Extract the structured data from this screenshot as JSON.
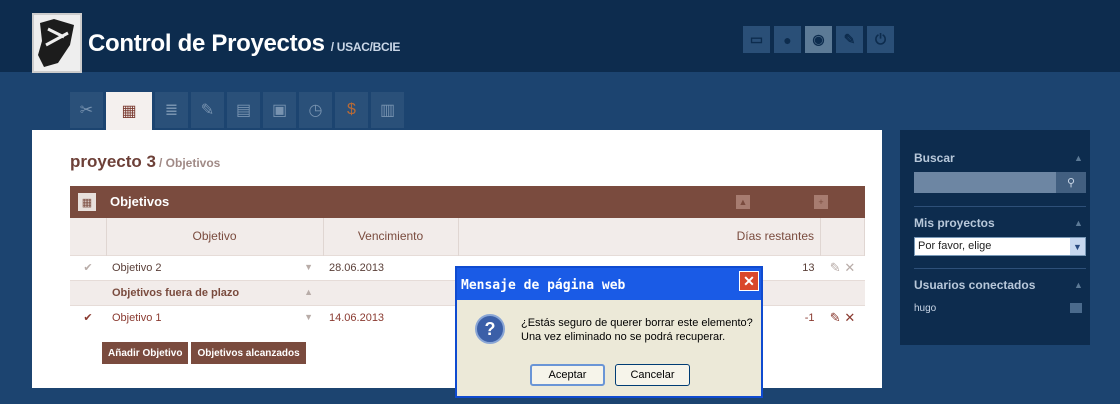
{
  "header": {
    "title": "Control de Proyectos",
    "subtitle": "/ USAC/BCIE",
    "icons": [
      "monitor-icon",
      "user-icon",
      "globe-icon",
      "wrench-icon",
      "power-icon"
    ]
  },
  "tabs": [
    "tools-icon",
    "calendar-icon",
    "list-icon",
    "edit-icon",
    "forms-icon",
    "document-icon",
    "clock-icon",
    "money-bag-icon",
    "clipboard-icon"
  ],
  "project": {
    "name": "proyecto 3",
    "section": "/ Objetivos"
  },
  "objectives": {
    "header": "Objetivos",
    "columns": [
      "Objetivo",
      "Vencimiento",
      "Días restantes"
    ],
    "rows": [
      {
        "name": "Objetivo 2",
        "due": "28.06.2013",
        "days": "13"
      }
    ],
    "late_section": "Objetivos fuera de plazo",
    "late_rows": [
      {
        "name": "Objetivo 1",
        "due": "14.06.2013",
        "days": "-1"
      }
    ],
    "add_button": "Añadir Objetivo",
    "achieved_button": "Objetivos alcanzados"
  },
  "sidebar": {
    "search_label": "Buscar",
    "projects_label": "Mis proyectos",
    "projects_selected": "Por favor, elige",
    "users_label": "Usuarios conectados",
    "user": "hugo"
  },
  "dialog": {
    "title": "Mensaje de página web",
    "line1": "¿Estás seguro de querer borrar este elemento?",
    "line2": "Una vez eliminado no se podrá recuperar.",
    "accept": "Aceptar",
    "cancel": "Cancelar"
  },
  "colors": {
    "brand_dark": "#0d2c4e",
    "accent_brown": "#7a4b3e",
    "dialog_blue": "#1a5be6"
  }
}
